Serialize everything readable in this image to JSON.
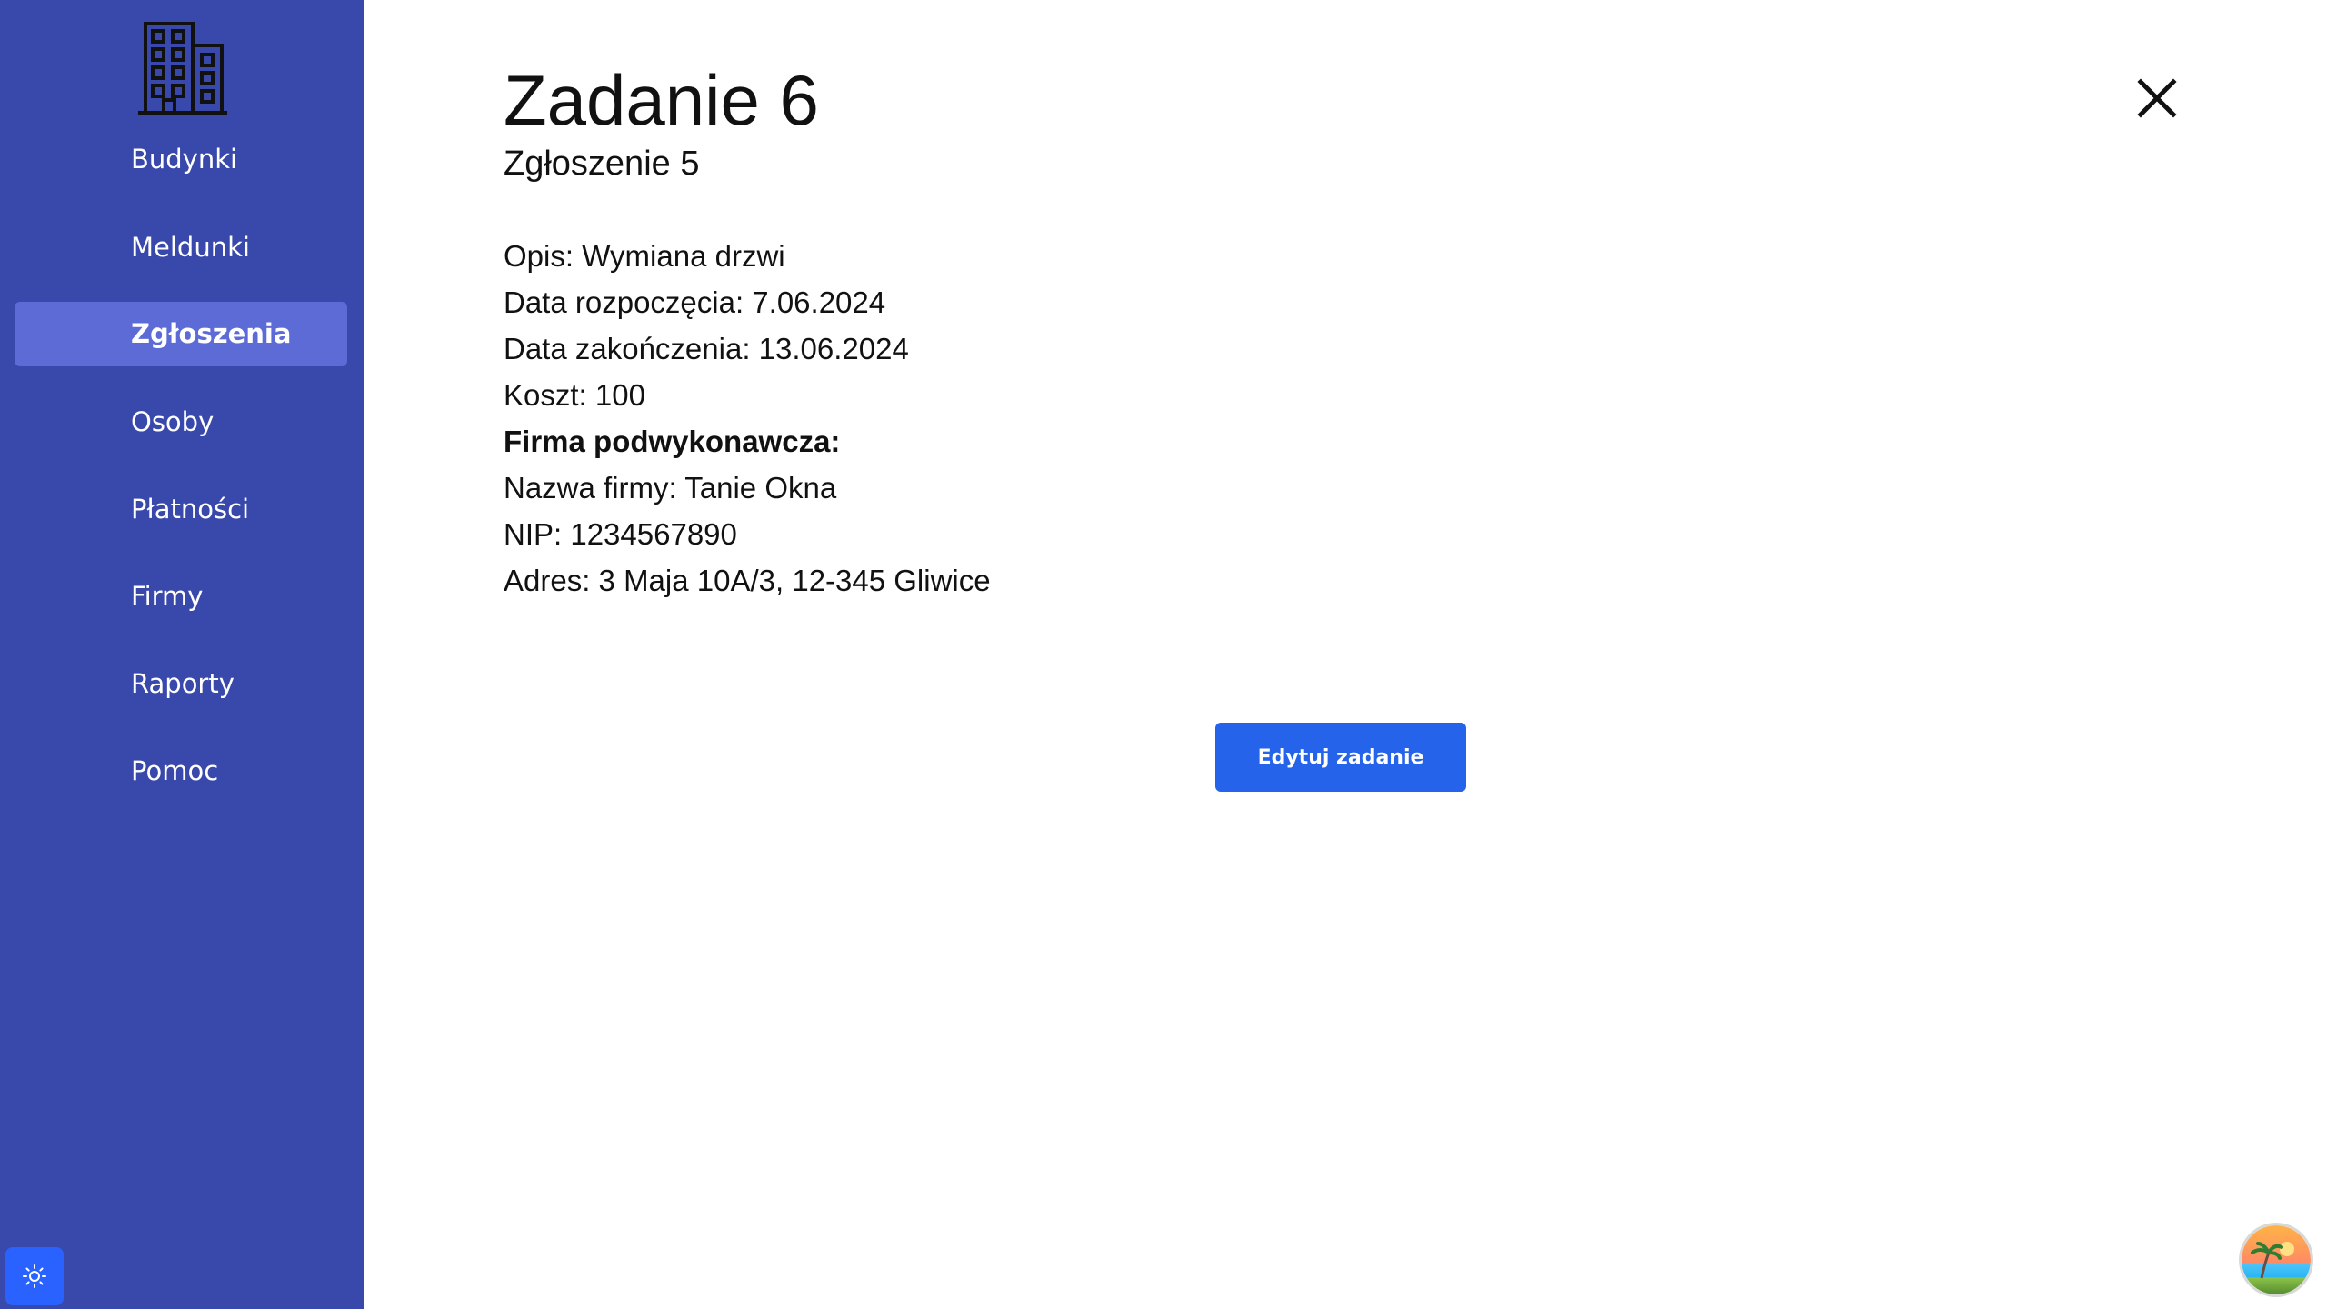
{
  "sidebar": {
    "logo_icon": "building-icon",
    "items": [
      {
        "label": "Budynki",
        "active": false
      },
      {
        "label": "Meldunki",
        "active": false
      },
      {
        "label": "Zgłoszenia",
        "active": true
      },
      {
        "label": "Osoby",
        "active": false
      },
      {
        "label": "Płatności",
        "active": false
      },
      {
        "label": "Firmy",
        "active": false
      },
      {
        "label": "Raporty",
        "active": false
      },
      {
        "label": "Pomoc",
        "active": false
      }
    ],
    "theme_toggle_icon": "sun-icon"
  },
  "main": {
    "title": "Zadanie 6",
    "subtitle": "Zgłoszenie 5",
    "details": {
      "description": "Opis: Wymiana drzwi",
      "start_date": "Data rozpoczęcia: 7.06.2024",
      "end_date": "Data zakończenia: 13.06.2024",
      "cost": "Koszt: 100",
      "subcontractor_header": "Firma podwykonawcza:",
      "company_name": "Nazwa firmy: Tanie Okna",
      "nip": "NIP: 1234567890",
      "address": "Adres: 3 Maja 10A/3, 12-345 Gliwice"
    },
    "edit_button_label": "Edytuj zadanie",
    "close_icon": "close-icon"
  },
  "colors": {
    "sidebar_bg": "#3949ab",
    "sidebar_active": "#5c6bd6",
    "primary_button": "#2563eb",
    "theme_button": "#2962ff"
  }
}
